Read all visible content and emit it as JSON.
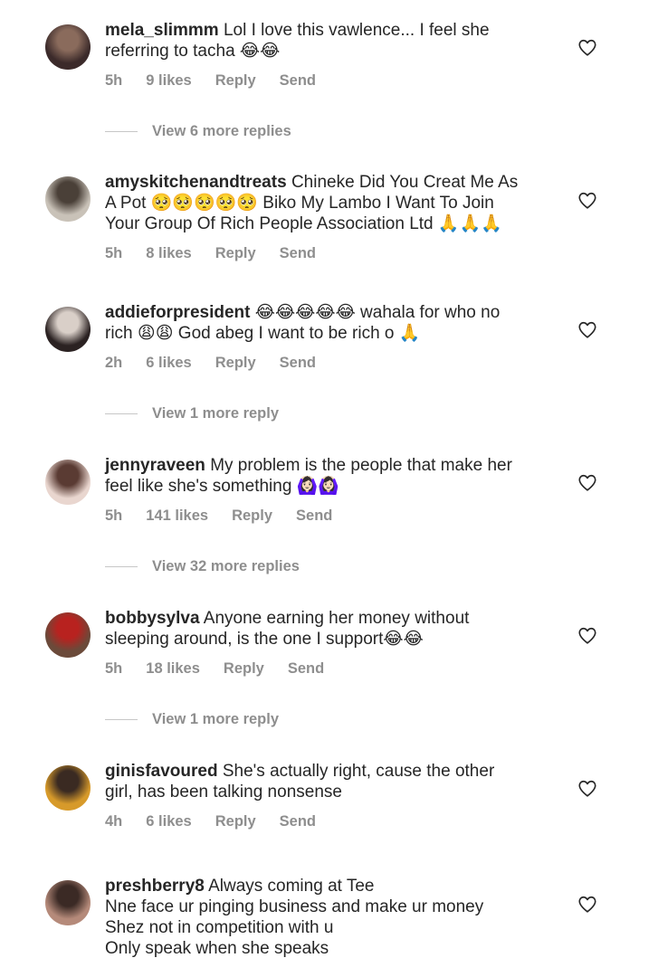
{
  "comments": [
    {
      "username": "mela_slimmm",
      "text": "Lol I love this vawlence... I feel she\nreferring to tacha 😂😂",
      "time": "5h",
      "likes": "9 likes",
      "reply": "Reply",
      "send": "Send",
      "view_replies": "View 6 more replies",
      "avatar_colors": [
        "#3b2a2a",
        "#8a6b5c"
      ]
    },
    {
      "username": "amyskitchenandtreats",
      "text": "Chineke Did You Creat Me As\nA Pot 🥺🥺🥺🥺🥺 Biko My Lambo I Want To Join\nYour Group Of Rich People Association Ltd 🙏🙏🙏",
      "time": "5h",
      "likes": "8 likes",
      "reply": "Reply",
      "send": "Send",
      "view_replies": "",
      "avatar_colors": [
        "#c9c2b8",
        "#4a4038"
      ]
    },
    {
      "username": "addieforpresident",
      "text": "😂😂😂😂😂 wahala for who no\nrich 😩😩 God abeg I want to be rich o 🙏",
      "time": "2h",
      "likes": "6 likes",
      "reply": "Reply",
      "send": "Send",
      "view_replies": "View 1 more reply",
      "avatar_colors": [
        "#2b2222",
        "#d9cfc8"
      ]
    },
    {
      "username": "jennyraveen",
      "text": "My problem is the people that make her\nfeel like she's something 🙆🏻‍♀️🙆🏻‍♀️",
      "time": "5h",
      "likes": "141 likes",
      "reply": "Reply",
      "send": "Send",
      "view_replies": "View 32 more replies",
      "avatar_colors": [
        "#e9d6cf",
        "#5a3b33"
      ]
    },
    {
      "username": "bobbysylva",
      "text": "Anyone earning her money without\nsleeping around, is the one I support😂😂",
      "time": "5h",
      "likes": "18 likes",
      "reply": "Reply",
      "send": "Send",
      "view_replies": "View 1 more reply",
      "avatar_colors": [
        "#6b4a3a",
        "#b8221f"
      ]
    },
    {
      "username": "ginisfavoured",
      "text": "She's actually right, cause the other\ngirl, has been talking nonsense",
      "time": "4h",
      "likes": "6 likes",
      "reply": "Reply",
      "send": "Send",
      "view_replies": "",
      "avatar_colors": [
        "#d79a2a",
        "#3a2a22"
      ]
    },
    {
      "username": "preshberry8",
      "text": "Always coming at Tee\nNne face ur pinging business and make ur money\nShez not in competition with u\nOnly speak when she speaks",
      "time": "",
      "likes": "",
      "reply": "",
      "send": "",
      "view_replies": "",
      "avatar_colors": [
        "#b58a7a",
        "#3b2a25"
      ]
    }
  ]
}
